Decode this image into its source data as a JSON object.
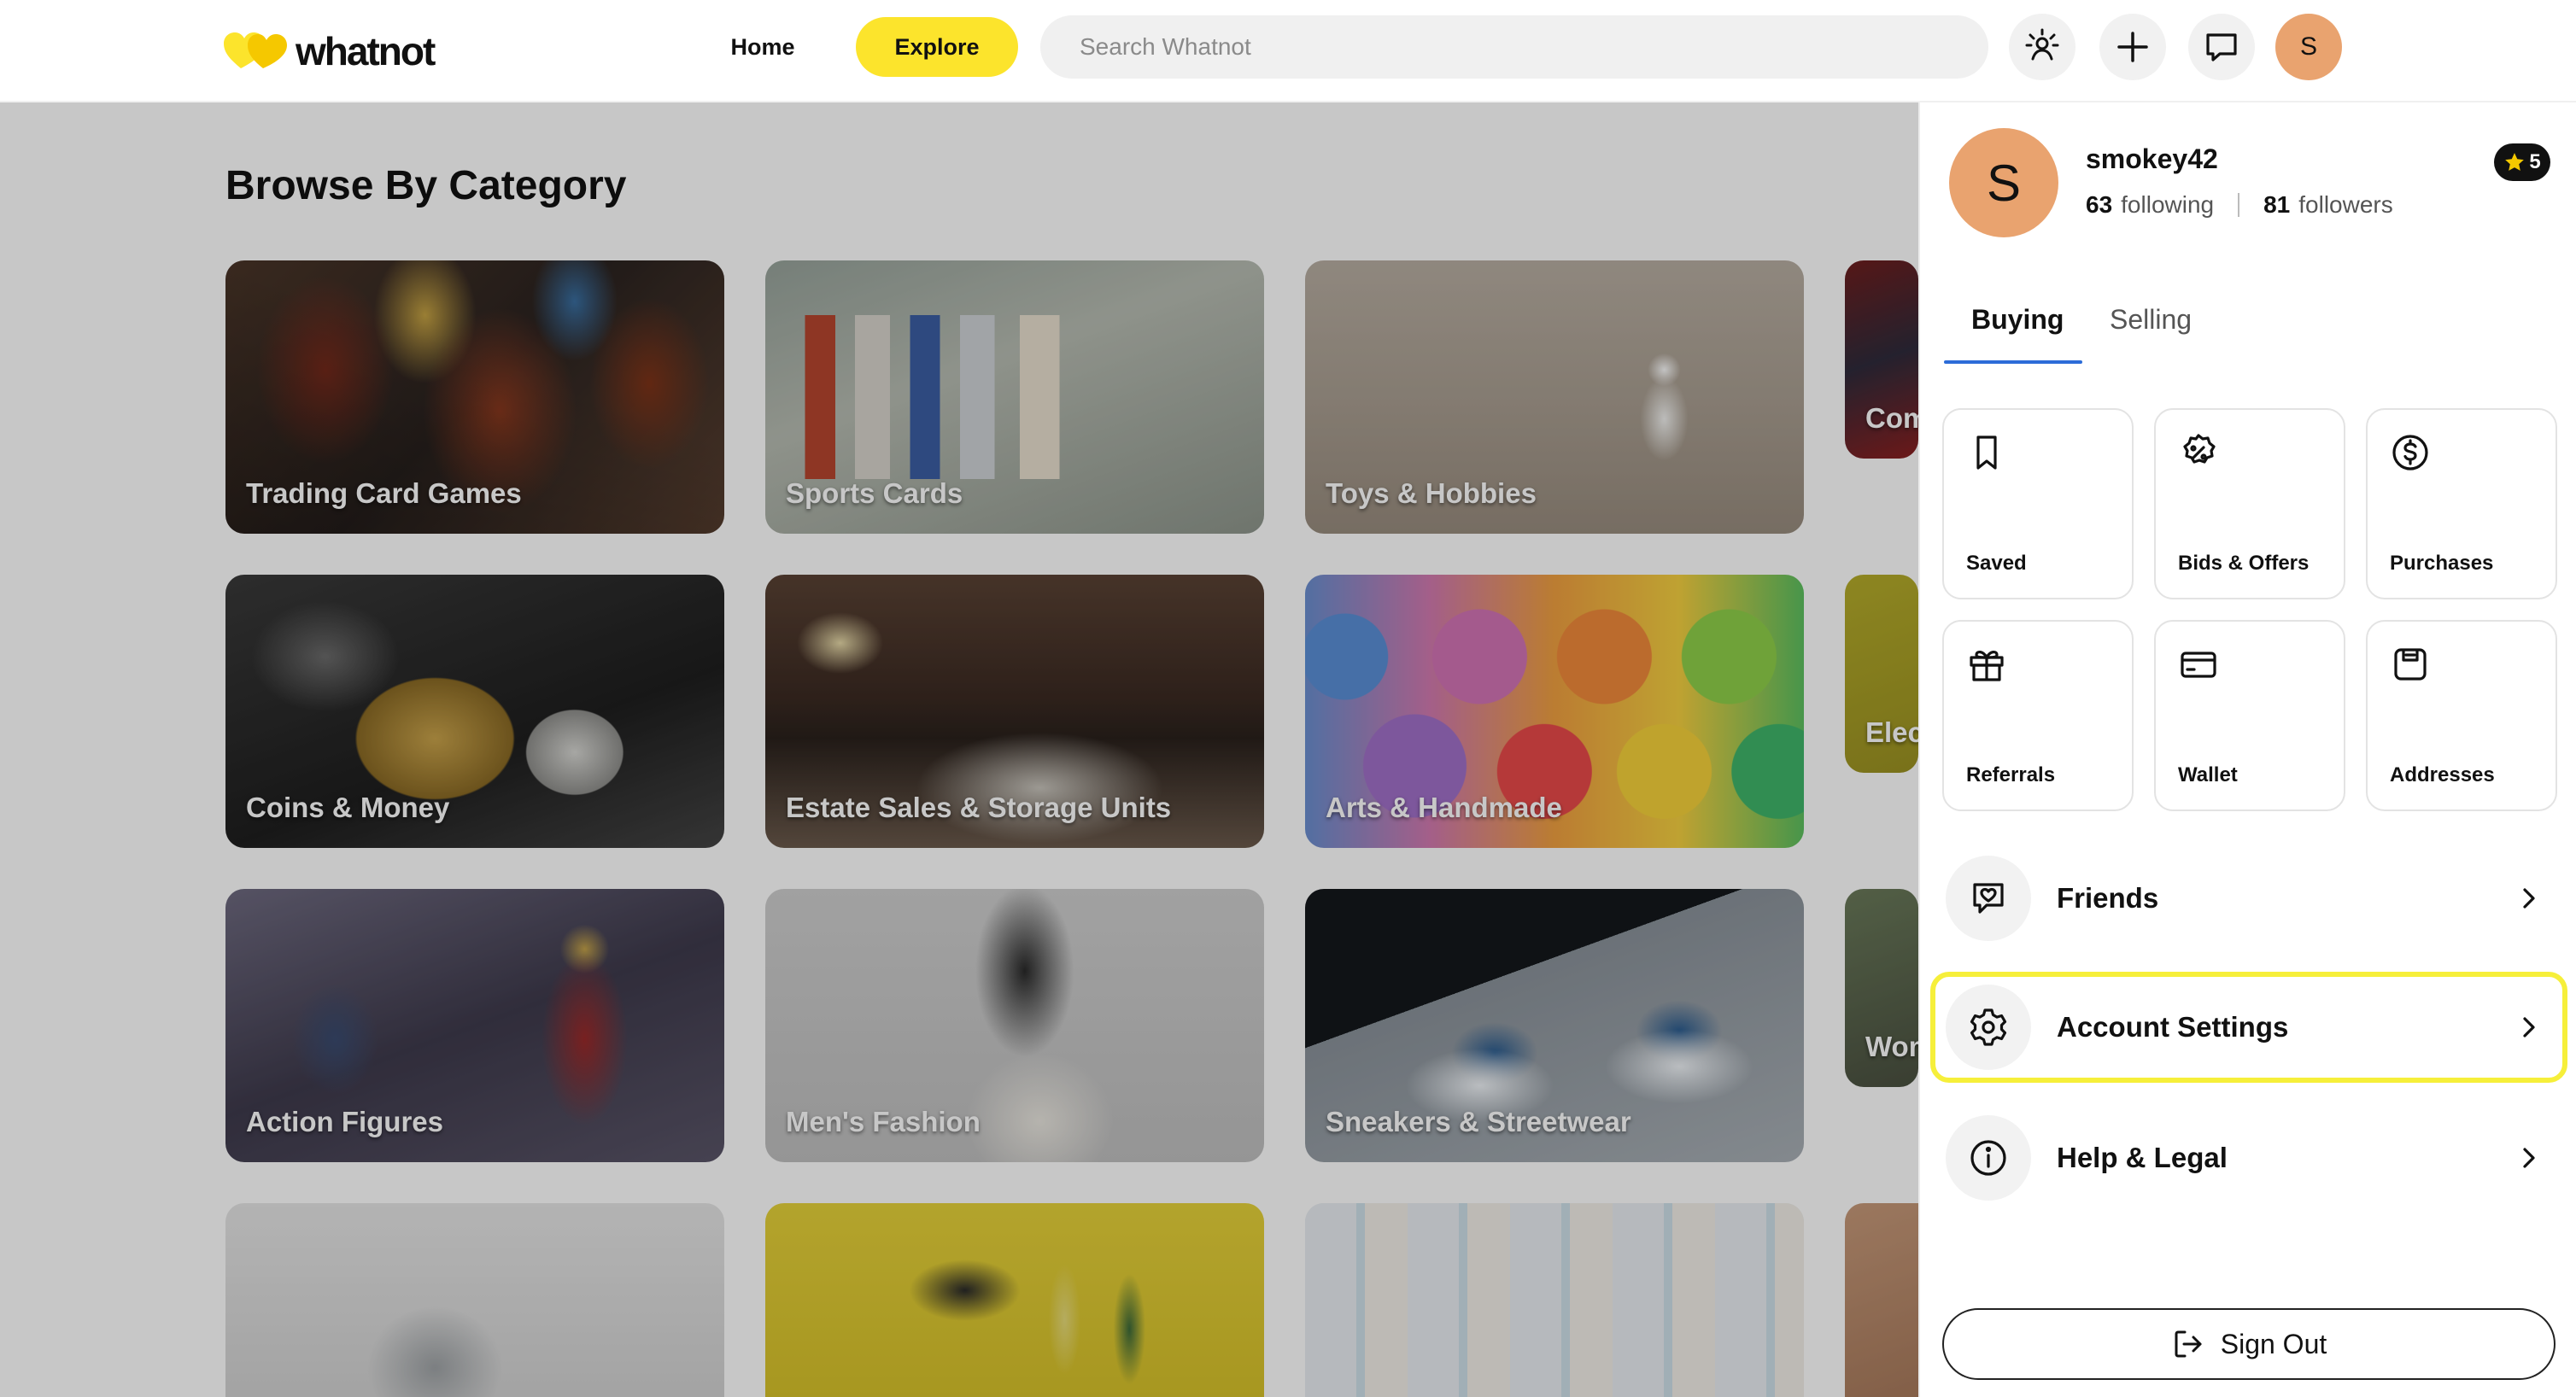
{
  "app": {
    "logo_text": "whatnot"
  },
  "nav": {
    "home": "Home",
    "explore": "Explore",
    "search_placeholder": "Search Whatnot",
    "profile_initial": "S"
  },
  "main": {
    "title": "Browse By Category",
    "categories": [
      {
        "label": "Trading Card Games"
      },
      {
        "label": "Sports Cards"
      },
      {
        "label": "Toys & Hobbies"
      },
      {
        "label": "Com"
      },
      {
        "label": "Coins & Money"
      },
      {
        "label": "Estate Sales & Storage Units"
      },
      {
        "label": "Arts & Handmade"
      },
      {
        "label": "Elec"
      },
      {
        "label": "Action Figures"
      },
      {
        "label": "Men's Fashion"
      },
      {
        "label": "Sneakers & Streetwear"
      },
      {
        "label": "Wom"
      }
    ]
  },
  "panel": {
    "avatar_initial": "S",
    "username": "smokey42",
    "following_count": "63",
    "following_label": "following",
    "followers_count": "81",
    "followers_label": "followers",
    "badge_value": "5",
    "tabs": {
      "buying": "Buying",
      "selling": "Selling"
    },
    "tiles": [
      {
        "label": "Saved",
        "icon": "bookmark-icon"
      },
      {
        "label": "Bids & Offers",
        "icon": "discount-badge-icon"
      },
      {
        "label": "Purchases",
        "icon": "dollar-circle-icon"
      },
      {
        "label": "Referrals",
        "icon": "gift-icon"
      },
      {
        "label": "Wallet",
        "icon": "credit-card-icon"
      },
      {
        "label": "Addresses",
        "icon": "mailbox-icon"
      }
    ],
    "rows": [
      {
        "label": "Friends",
        "icon": "heart-chat-icon"
      },
      {
        "label": "Account Settings",
        "icon": "gear-icon"
      },
      {
        "label": "Help & Legal",
        "icon": "info-icon"
      }
    ],
    "sign_out": "Sign Out"
  },
  "colors": {
    "accent": "#fce42c",
    "avatar": "#e9a36f",
    "tab_underline": "#2c6cd8",
    "highlight": "#f6ef3a"
  }
}
